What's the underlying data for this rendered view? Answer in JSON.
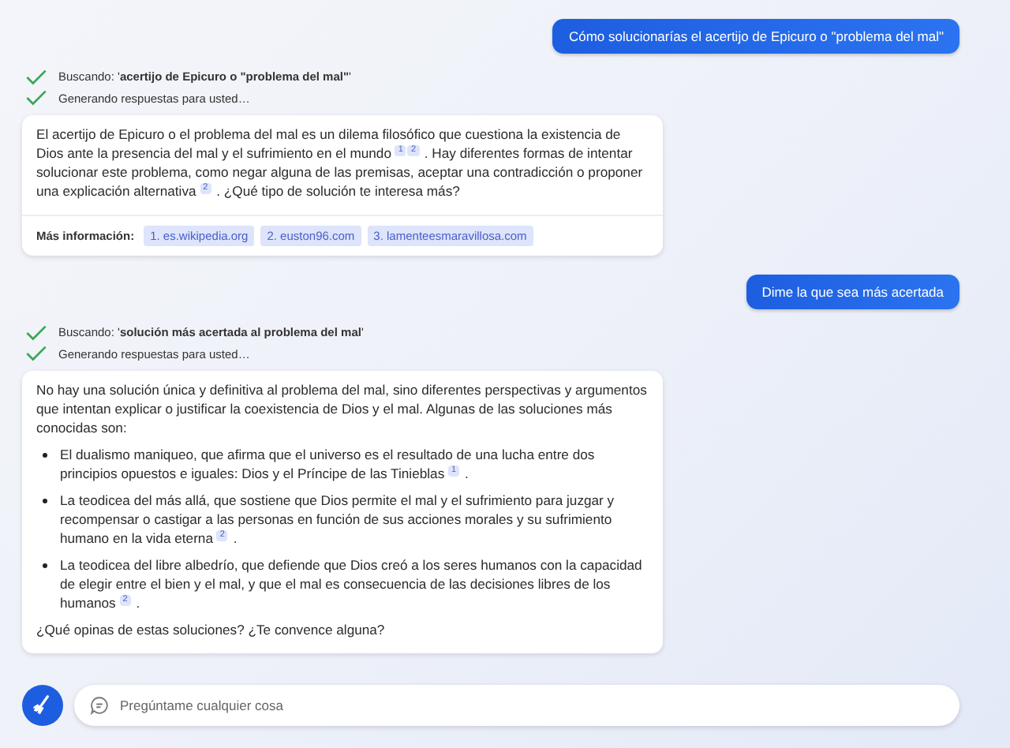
{
  "messages": [
    {
      "kind": "user",
      "text": "Cómo solucionarías el acertijo de Epicuro o \"problema del mal\""
    },
    {
      "kind": "status",
      "text": "Buscando: '**acertijo de Epicuro o \"problema del mal\"**'"
    },
    {
      "kind": "status",
      "text": "Generando respuestas para usted…"
    },
    {
      "kind": "answer",
      "blocks": [
        {
          "kind": "paragraph",
          "segments": [
            {
              "kind": "text",
              "text": "El acertijo de Epicuro o el problema del mal es un dilema filosófico que cuestiona la existencia de Dios ante la presencia del mal y el sufrimiento en el mundo "
            },
            {
              "kind": "cite",
              "text": "1"
            },
            {
              "kind": "cite",
              "text": "2"
            },
            {
              "kind": "text",
              "text": " . Hay diferentes formas de intentar solucionar este problema, como negar alguna de las premisas, aceptar una contradicción o proponer una explicación alternativa "
            },
            {
              "kind": "cite",
              "text": "2"
            },
            {
              "kind": "text",
              "text": " . ¿Qué tipo de solución te interesa más?"
            }
          ]
        }
      ],
      "sources": {
        "label": "Más información:",
        "links": [
          "1. es.wikipedia.org",
          "2. euston96.com",
          "3. lamenteesmaravillosa.com"
        ]
      }
    },
    {
      "kind": "user",
      "text": "Dime la que sea más acertada"
    },
    {
      "kind": "status",
      "text": "Buscando: '**solución más acertada al problema del mal**'"
    },
    {
      "kind": "status",
      "text": "Generando respuestas para usted…"
    },
    {
      "kind": "answer",
      "blocks": [
        {
          "kind": "paragraph",
          "segments": [
            {
              "kind": "text",
              "text": "No hay una solución única y definitiva al problema del mal, sino diferentes perspectivas y argumentos que intentan explicar o justificar la coexistencia de Dios y el mal. Algunas de las soluciones más conocidas son:"
            }
          ]
        },
        {
          "kind": "bullet",
          "segments": [
            {
              "kind": "text",
              "text": "El dualismo maniqueo, que afirma que el universo es el resultado de una lucha entre dos principios opuestos e iguales: Dios y el Príncipe de las Tinieblas "
            },
            {
              "kind": "cite",
              "text": "1"
            },
            {
              "kind": "text",
              "text": " ."
            }
          ]
        },
        {
          "kind": "bullet",
          "segments": [
            {
              "kind": "text",
              "text": "La teodicea del más allá, que sostiene que Dios permite el mal y el sufrimiento para juzgar y recompensar o castigar a las personas en función de sus acciones morales y su sufrimiento humano en la vida eterna "
            },
            {
              "kind": "cite",
              "text": "2"
            },
            {
              "kind": "text",
              "text": " ."
            }
          ]
        },
        {
          "kind": "bullet",
          "segments": [
            {
              "kind": "text",
              "text": "La teodicea del libre albedrío, que defiende que Dios creó a los seres humanos con la capacidad de elegir entre el bien y el mal, y que el mal es consecuencia de las decisiones libres de los humanos "
            },
            {
              "kind": "cite",
              "text": "2"
            },
            {
              "kind": "text",
              "text": " ."
            }
          ]
        },
        {
          "kind": "paragraph",
          "segments": [
            {
              "kind": "text",
              "text": "¿Qué opinas de estas soluciones? ¿Te convence alguna?"
            }
          ]
        }
      ]
    }
  ],
  "input": {
    "placeholder": "Pregúntame cualquier cosa"
  }
}
